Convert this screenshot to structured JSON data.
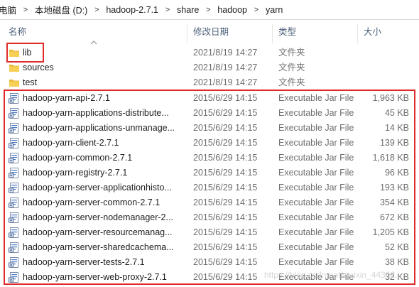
{
  "breadcrumb": {
    "items": [
      "电脑",
      "本地磁盘 (D:)",
      "hadoop-2.7.1",
      "share",
      "hadoop",
      "yarn"
    ],
    "separator": ">"
  },
  "columns": {
    "name": "名称",
    "date": "修改日期",
    "type": "类型",
    "size": "大小"
  },
  "folders": [
    {
      "name": "lib",
      "date": "2021/8/19 14:27",
      "type": "文件夹",
      "size": ""
    },
    {
      "name": "sources",
      "date": "2021/8/19 14:27",
      "type": "文件夹",
      "size": ""
    },
    {
      "name": "test",
      "date": "2021/8/19 14:27",
      "type": "文件夹",
      "size": ""
    }
  ],
  "files": [
    {
      "name": "hadoop-yarn-api-2.7.1",
      "date": "2015/6/29 14:15",
      "type": "Executable Jar File",
      "size": "1,963 KB"
    },
    {
      "name": "hadoop-yarn-applications-distribute...",
      "date": "2015/6/29 14:15",
      "type": "Executable Jar File",
      "size": "45 KB"
    },
    {
      "name": "hadoop-yarn-applications-unmanage...",
      "date": "2015/6/29 14:15",
      "type": "Executable Jar File",
      "size": "14 KB"
    },
    {
      "name": "hadoop-yarn-client-2.7.1",
      "date": "2015/6/29 14:15",
      "type": "Executable Jar File",
      "size": "139 KB"
    },
    {
      "name": "hadoop-yarn-common-2.7.1",
      "date": "2015/6/29 14:15",
      "type": "Executable Jar File",
      "size": "1,618 KB"
    },
    {
      "name": "hadoop-yarn-registry-2.7.1",
      "date": "2015/6/29 14:15",
      "type": "Executable Jar File",
      "size": "96 KB"
    },
    {
      "name": "hadoop-yarn-server-applicationhisto...",
      "date": "2015/6/29 14:15",
      "type": "Executable Jar File",
      "size": "193 KB"
    },
    {
      "name": "hadoop-yarn-server-common-2.7.1",
      "date": "2015/6/29 14:15",
      "type": "Executable Jar File",
      "size": "354 KB"
    },
    {
      "name": "hadoop-yarn-server-nodemanager-2...",
      "date": "2015/6/29 14:15",
      "type": "Executable Jar File",
      "size": "672 KB"
    },
    {
      "name": "hadoop-yarn-server-resourcemanag...",
      "date": "2015/6/29 14:15",
      "type": "Executable Jar File",
      "size": "1,205 KB"
    },
    {
      "name": "hadoop-yarn-server-sharedcachema...",
      "date": "2015/6/29 14:15",
      "type": "Executable Jar File",
      "size": "52 KB"
    },
    {
      "name": "hadoop-yarn-server-tests-2.7.1",
      "date": "2015/6/29 14:15",
      "type": "Executable Jar File",
      "size": "38 KB"
    },
    {
      "name": "hadoop-yarn-server-web-proxy-2.7.1",
      "date": "2015/6/29 14:15",
      "type": "Executable Jar File",
      "size": "32 KB"
    }
  ],
  "icons": {
    "folder": "folder-icon",
    "jar": "jar-file-icon",
    "sort": "sort-up-icon"
  },
  "colors": {
    "highlight": "#e02a2a",
    "folder": "#f5c542",
    "header_text": "#4c607a"
  },
  "watermark": "https://blog.csdn.net/weixin_44302..."
}
